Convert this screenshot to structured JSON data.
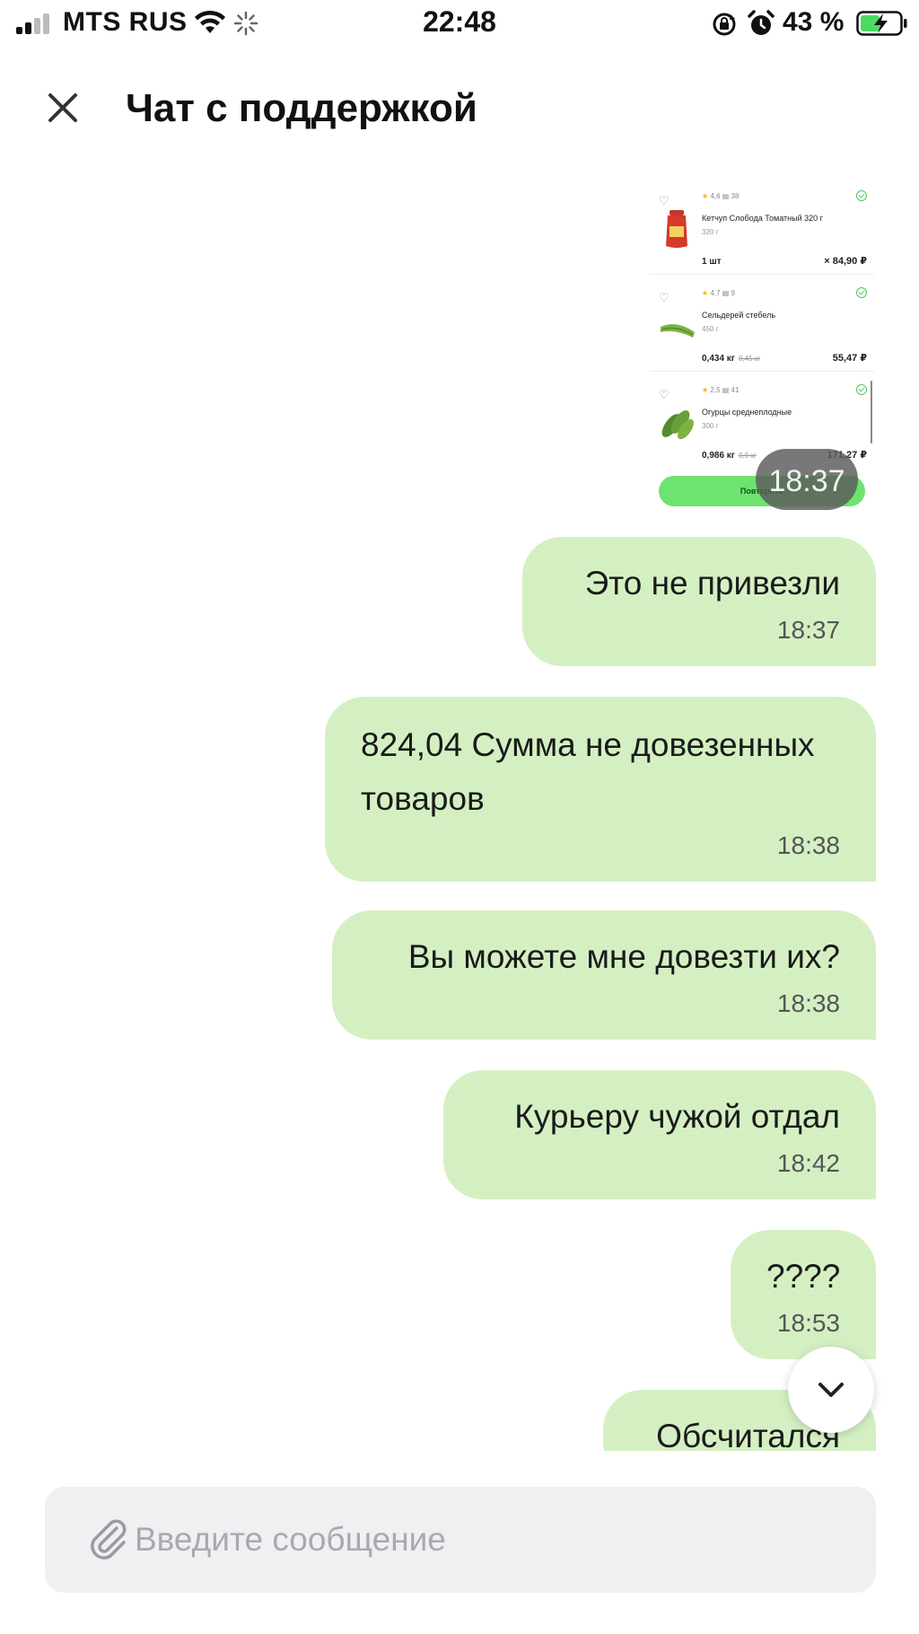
{
  "status_bar": {
    "carrier": "MTS RUS",
    "time": "22:48",
    "battery_percent": "43 %",
    "icons": [
      "signal-icon",
      "wifi-icon",
      "loading-icon",
      "rotation-lock-icon",
      "alarm-icon",
      "battery-charging-icon"
    ]
  },
  "header": {
    "title": "Чат с поддержкой",
    "close_icon": "close-icon"
  },
  "attachment": {
    "items": [
      {
        "rating": "4,6",
        "reviews": "38",
        "name": "Кетчуп Слобода Томатный 320 г",
        "weight": "320 г",
        "qty": "1 шт",
        "qty_old": "",
        "price": "× 84,90 ₽"
      },
      {
        "rating": "4,7",
        "reviews": "9",
        "name": "Сельдерей стебель",
        "weight": "450 г",
        "qty": "0,434 кг",
        "qty_old": "0,45 кг",
        "price": "55,47 ₽"
      },
      {
        "rating": "2,5",
        "reviews": "41",
        "name": "Огурцы среднеплодные",
        "weight": "300 г",
        "qty": "0,986 кг",
        "qty_old": "0,9 кг",
        "price": "171,27 ₽"
      }
    ],
    "repeat_label": "Повторить",
    "time": "18:37"
  },
  "messages": [
    {
      "text": "Это не привезли",
      "time": "18:37"
    },
    {
      "text": "824,04 Сумма не довезенных товаров",
      "time": "18:38"
    },
    {
      "text": "Вы можете мне довезти их?",
      "time": "18:38"
    },
    {
      "text": "Курьеру чужой отдал",
      "time": "18:42"
    },
    {
      "text": "????",
      "time": "18:53"
    },
    {
      "text": "Обсчитался",
      "time": ""
    }
  ],
  "input": {
    "placeholder": "Введите сообщение",
    "value": ""
  },
  "colors": {
    "bubble": "#d4f0c3",
    "accent_green": "#6fe36f",
    "input_bg": "#eff0f2"
  }
}
